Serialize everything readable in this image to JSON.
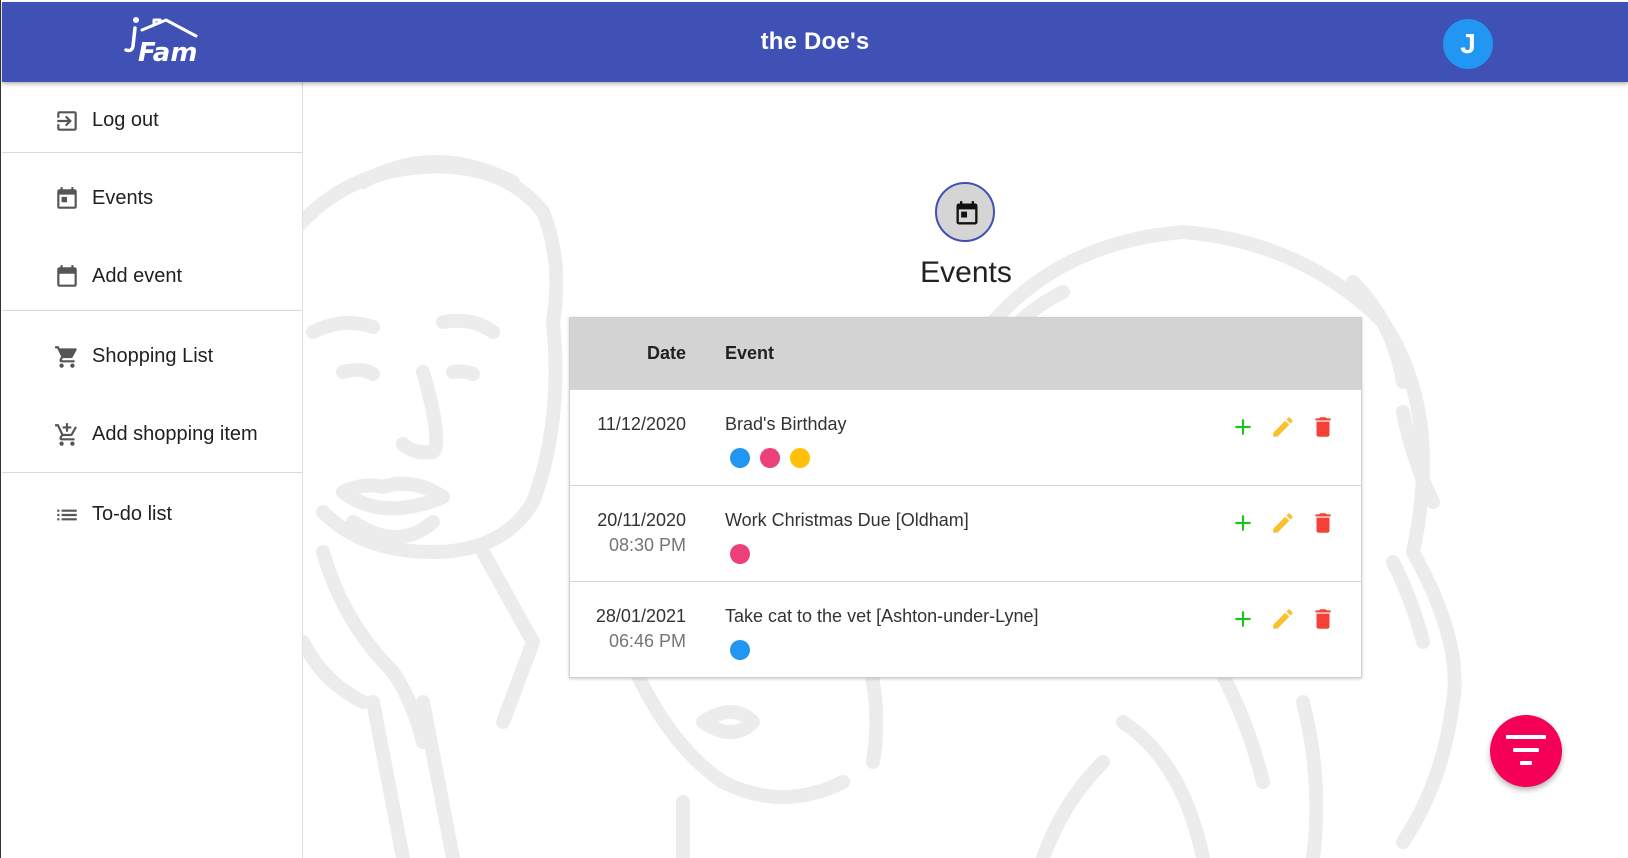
{
  "header": {
    "family_name": "the Doe's",
    "logo_text": "iFam",
    "avatar_initial": "J",
    "bar_color": "#3f51b5",
    "avatar_color": "#2196f3"
  },
  "sidebar": {
    "items": [
      {
        "label": "Log out",
        "icon": "logout-icon"
      },
      {
        "label": "Events",
        "icon": "calendar-icon"
      },
      {
        "label": "Add event",
        "icon": "calendar-add-icon"
      },
      {
        "label": "Shopping List",
        "icon": "cart-icon"
      },
      {
        "label": "Add shopping item",
        "icon": "cart-add-icon"
      },
      {
        "label": "To-do list",
        "icon": "list-icon"
      }
    ]
  },
  "main": {
    "title": "Events",
    "title_icon": "calendar-icon",
    "table": {
      "headers": {
        "date": "Date",
        "event": "Event"
      },
      "rows": [
        {
          "date": "11/12/2020",
          "time": "",
          "event": "Brad's Birthday",
          "members": [
            "#2196f3",
            "#ec407a",
            "#ffc107"
          ]
        },
        {
          "date": "20/11/2020",
          "time": "08:30 PM",
          "event": "Work Christmas Due [Oldham]",
          "members": [
            "#ec407a"
          ]
        },
        {
          "date": "28/01/2021",
          "time": "06:46 PM",
          "event": "Take cat to the vet [Ashton-under-Lyne]",
          "members": [
            "#2196f3"
          ]
        }
      ],
      "action_colors": {
        "add": "#21c21b",
        "edit": "#fbc02d",
        "delete": "#f44336"
      }
    }
  },
  "fab": {
    "icon": "filter-icon",
    "color": "#f50057"
  }
}
